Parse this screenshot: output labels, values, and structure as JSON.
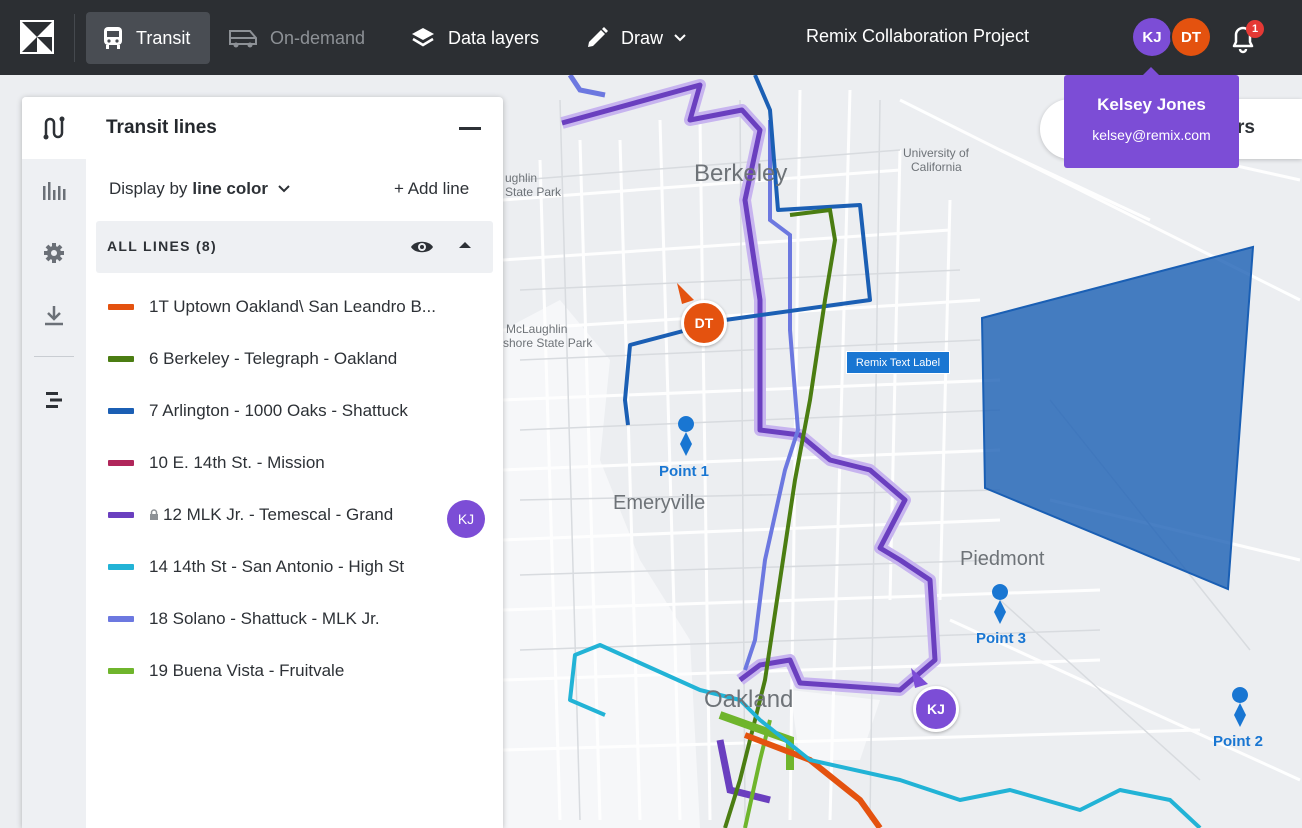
{
  "topbar": {
    "logo_icon": "remix-logo-icon",
    "tabs": [
      {
        "label": "Transit",
        "icon": "bus-icon",
        "active": true
      },
      {
        "label": "On-demand",
        "icon": "van-icon",
        "active": false
      },
      {
        "label": "Data layers",
        "icon": "layers-icon",
        "active": false
      },
      {
        "label": "Draw",
        "icon": "pencil-icon",
        "active": false
      }
    ],
    "project_title": "Remix Collaboration Project",
    "collaborators": [
      {
        "initials": "KJ",
        "color": "#7c4dd6"
      },
      {
        "initials": "DT",
        "color": "#e4520f"
      }
    ],
    "notification_count": "1"
  },
  "tooltip": {
    "name": "Kelsey Jones",
    "email": "kelsey@remix.com"
  },
  "search_chip": {
    "text": "rs"
  },
  "panel": {
    "title": "Transit lines",
    "display_by_prefix": "Display by",
    "display_by_value": "line color",
    "add_line": "+ Add line",
    "all_lines_label": "ALL LINES (8)",
    "rail_icons": [
      "routes-icon",
      "chart-icon",
      "settings-icon",
      "download-icon",
      "timeline-icon"
    ],
    "lines": [
      {
        "label": "1T Uptown Oakland\\ San Leandro B...",
        "color": "#e4520f",
        "locked": false
      },
      {
        "label": "6 Berkeley - Telegraph - Oakland",
        "color": "#4b7d12",
        "locked": false
      },
      {
        "label": "7 Arlington - 1000 Oaks - Shattuck",
        "color": "#1b5fb4",
        "locked": false
      },
      {
        "label": "10 E. 14th St. - Mission",
        "color": "#b0265a",
        "locked": false
      },
      {
        "label": "12 MLK Jr. - Temescal - Grand",
        "color": "#6a3fbf",
        "locked": true
      },
      {
        "label": "14 14th St - San Antonio - High St",
        "color": "#22b3d6",
        "locked": false
      },
      {
        "label": "18 Solano - Shattuck - MLK Jr.",
        "color": "#6c78e0",
        "locked": false
      },
      {
        "label": "19 Buena Vista - Fruitvale",
        "color": "#6fb52c",
        "locked": false
      }
    ],
    "row_collaborator": "KJ"
  },
  "map": {
    "places": {
      "berkeley": "Berkeley",
      "emeryville": "Emeryville",
      "oakland": "Oakland",
      "piedmont": "Piedmont",
      "uc_1": "University of",
      "uc_2": "California",
      "park1_1": "ughlin",
      "park1_2": "State Park",
      "park2_1": "McLaughlin",
      "park2_2": "shore State Park"
    },
    "points": [
      "Point 1",
      "Point 2",
      "Point 3"
    ],
    "text_label": "Remix Text Label",
    "cursor_dt": "DT",
    "cursor_kj": "KJ"
  }
}
